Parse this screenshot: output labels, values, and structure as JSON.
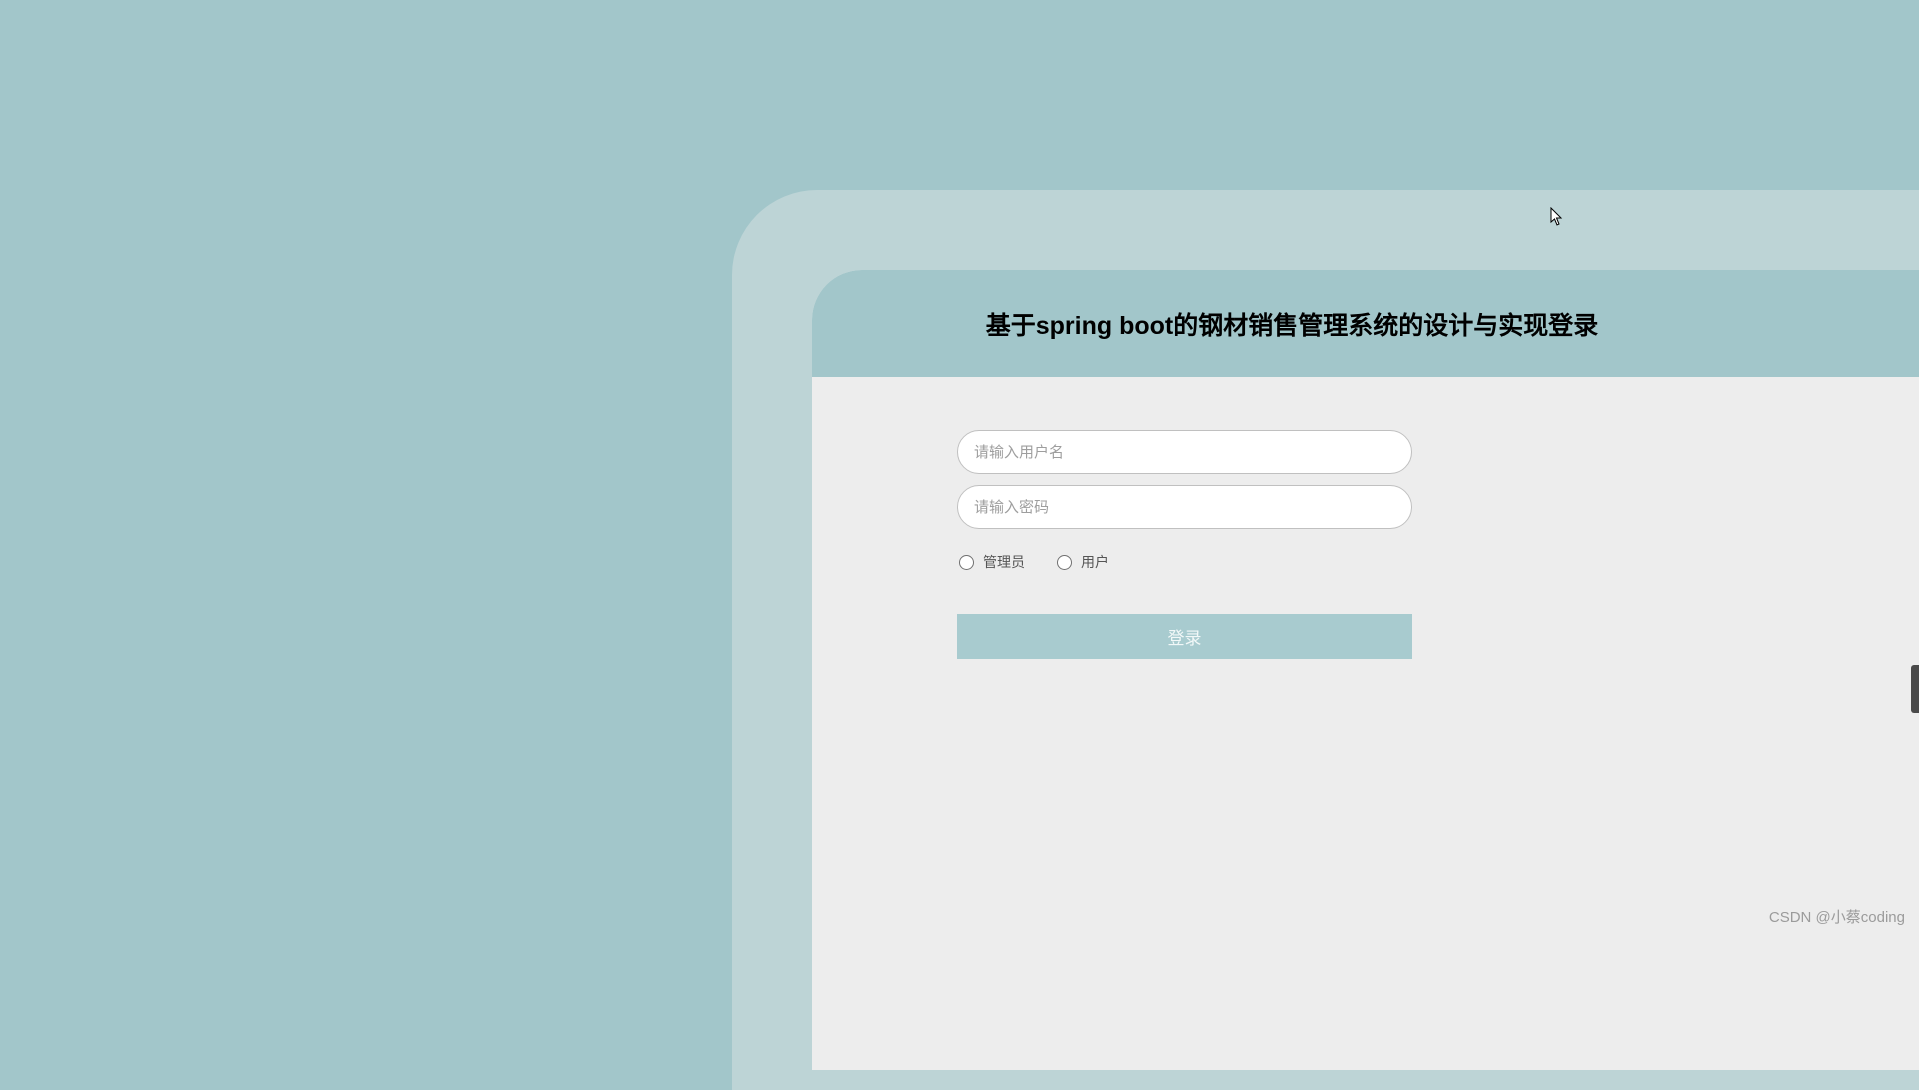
{
  "header": {
    "title": "基于spring boot的钢材销售管理系统的设计与实现登录"
  },
  "form": {
    "username_placeholder": "请输入用户名",
    "password_placeholder": "请输入密码",
    "roles": {
      "admin": "管理员",
      "user": "用户"
    },
    "login_button_label": "登录"
  },
  "watermark": "CSDN @小蔡coding"
}
